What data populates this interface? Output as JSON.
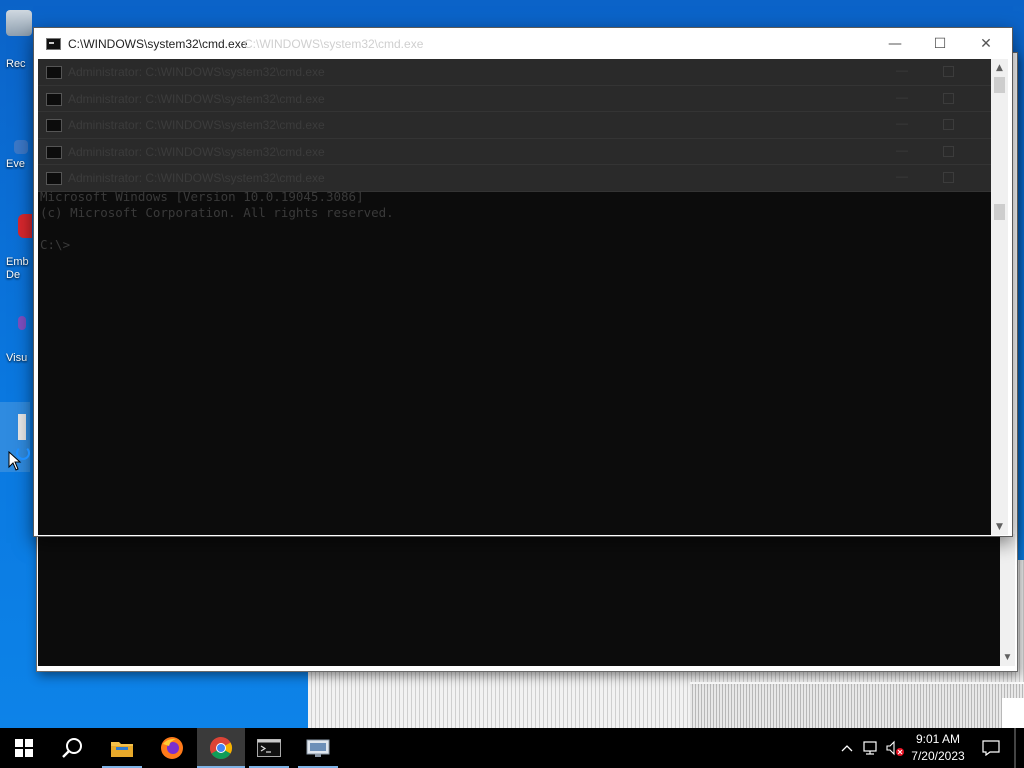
{
  "desktop": {
    "icons": [
      {
        "label": "Rec"
      },
      {
        "label": "Eve"
      },
      {
        "label": "Emb De"
      },
      {
        "label": "Visu"
      }
    ]
  },
  "window": {
    "title": "C:\\WINDOWS\\system32\\cmd.exe",
    "title_ghost": "C:\\WINDOWS\\system32\\cmd.exe",
    "minimize_glyph": "—",
    "maximize_glyph": "☐",
    "close_glyph": "✕"
  },
  "ghost_rows": [
    {
      "text": "Administrator: C:\\WINDOWS\\system32\\cmd.exe"
    },
    {
      "text": "Administrator: C:\\WINDOWS\\system32\\cmd.exe"
    },
    {
      "text": "Administrator: C:\\WINDOWS\\system32\\cmd.exe"
    },
    {
      "text": "Administrator: C:\\WINDOWS\\system32\\cmd.exe"
    },
    {
      "text": "Administrator: C:\\WINDOWS\\system32\\cmd.exe"
    }
  ],
  "console": {
    "line1": "Microsoft Windows [Version 10.0.19045.3086]",
    "line2": "(c) Microsoft Corporation. All rights reserved.",
    "line3": "",
    "prompt": "C:\\>"
  },
  "scrollbar": {
    "up_glyph": "▲",
    "down_glyph": "▼"
  },
  "taskbar": {
    "items": [
      {
        "name": "start",
        "icon": "windows-logo-icon"
      },
      {
        "name": "search",
        "icon": "search-icon"
      },
      {
        "name": "file-explorer",
        "icon": "folder-icon"
      },
      {
        "name": "firefox",
        "icon": "firefox-icon"
      },
      {
        "name": "chrome",
        "icon": "chrome-icon"
      },
      {
        "name": "cmd",
        "icon": "terminal-icon"
      },
      {
        "name": "network-app",
        "icon": "monitor-icon"
      }
    ],
    "clock_time": "9:01 AM",
    "clock_date": "7/20/2023"
  },
  "colors": {
    "taskbar": "#000000",
    "console_bg": "#0c0c0c",
    "accent": "#0078d7"
  }
}
